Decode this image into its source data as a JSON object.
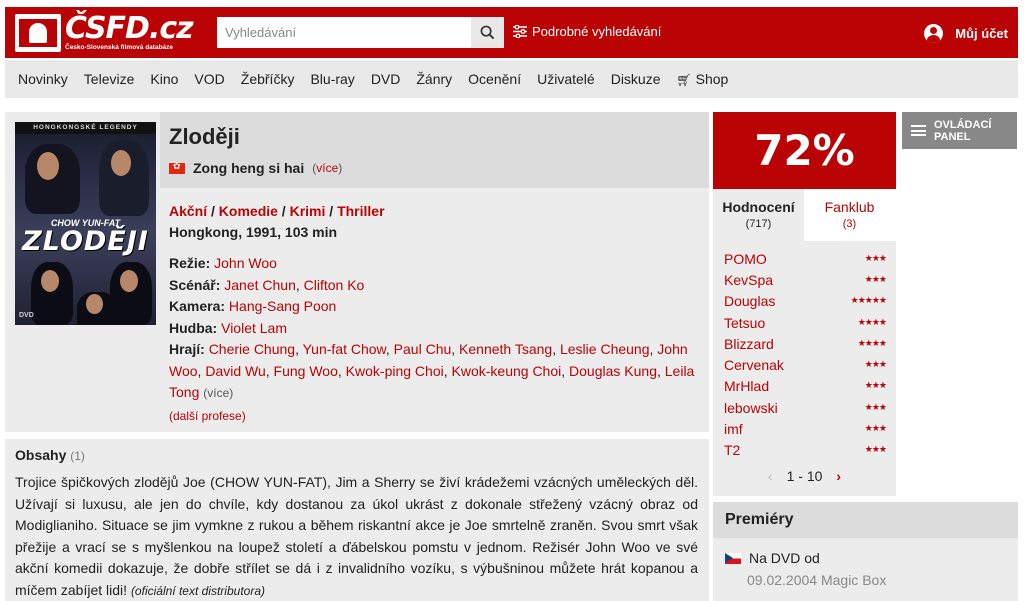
{
  "header": {
    "logo_text": "ČSFD.cz",
    "logo_sub": "Česko-Slovenská filmová databáze",
    "search_placeholder": "Vyhledávání",
    "advanced_search": "Podrobné vyhledávání",
    "account": "Můj účet"
  },
  "nav": [
    "Novinky",
    "Televize",
    "Kino",
    "VOD",
    "Žebříčky",
    "Blu-ray",
    "DVD",
    "Žánry",
    "Ocenění",
    "Uživatelé",
    "Diskuze",
    "Shop"
  ],
  "poster": {
    "band": "HONGKONGSKÉ LEGENDY",
    "actor": "CHOW YUN-FAT",
    "title": "ZLODĚJI",
    "format": "DVD"
  },
  "film": {
    "title": "Zloději",
    "original_title": "Zong heng si hai",
    "more_titles": "(více)",
    "genres": [
      "Akční",
      "Komedie",
      "Krimi",
      "Thriller"
    ],
    "genre_sep": " / ",
    "origin": "Hongkong, 1991, 103 min",
    "director_label": "Režie:",
    "director": "John Woo",
    "writer_label": "Scénář:",
    "writers": [
      "Janet Chun",
      "Clifton Ko"
    ],
    "camera_label": "Kamera:",
    "camera": "Hang-Sang Poon",
    "music_label": "Hudba:",
    "music": "Violet Lam",
    "cast_label": "Hrají:",
    "cast": [
      "Cherie Chung",
      "Yun-fat Chow",
      "Paul Chu",
      "Kenneth Tsang",
      "Leslie Cheung",
      "John Woo",
      "David Wu",
      "Fung Woo",
      "Kwok-ping Choi",
      "Kwok-keung Choi",
      "Douglas Kung",
      "Leila Tong"
    ],
    "cast_more": "(více)",
    "other_roles": "(další profese)"
  },
  "plot": {
    "heading": "Obsahy",
    "count": "(1)",
    "text": "Trojice špičkových zlodějů Joe (CHOW YUN-FAT), Jim a Sherry se živí krádežemi vzácných uměleckých děl. Užívají si luxusu, ale jen do chvíle, kdy dostanou za úkol ukrást z dokonale střežený vzácný obraz od Modiglianiho. Situace se jim vymkne z rukou a během riskantní akce je Joe smrtelně zraněn. Svou smrt však přežije a vrací se s myšlenkou na loupež století a ďábelskou pomstu v jednom. Režisér John Woo ve své akční komedii dokazuje, že dobře střílet se dá i z invalidního vozíku, s výbušninou můžete hrát kopanou a míčem zabíjet lidi!",
    "source": "(oficiální text distributora)"
  },
  "rating": {
    "value": "72%",
    "tab_ratings": "Hodnocení",
    "tab_ratings_count": "(717)",
    "tab_fanclub": "Fanklub",
    "tab_fanclub_count": "(3)",
    "users": [
      {
        "name": "POMO",
        "stars": "★★★"
      },
      {
        "name": "KevSpa",
        "stars": "★★★"
      },
      {
        "name": "Douglas",
        "stars": "★★★★★"
      },
      {
        "name": "Tetsuo",
        "stars": "★★★★"
      },
      {
        "name": "Blizzard",
        "stars": "★★★★"
      },
      {
        "name": "Cervenak",
        "stars": "★★★"
      },
      {
        "name": "MrHlad",
        "stars": "★★★"
      },
      {
        "name": "lebowski",
        "stars": "★★★"
      },
      {
        "name": "imf",
        "stars": "★★★"
      },
      {
        "name": "T2",
        "stars": "★★★"
      }
    ],
    "pager": "1 - 10",
    "pager_prev": "‹",
    "pager_next": "›",
    "star_color": "#ba0305"
  },
  "panel_button": "OVLÁDACÍ PANEL",
  "premiere": {
    "heading": "Premiéry",
    "label": "Na DVD od",
    "date": "09.02.2004 Magic Box"
  },
  "colors": {
    "brand": "#ba0305",
    "panel_bg": "#ececec",
    "header_bg": "#dcdcdc"
  }
}
